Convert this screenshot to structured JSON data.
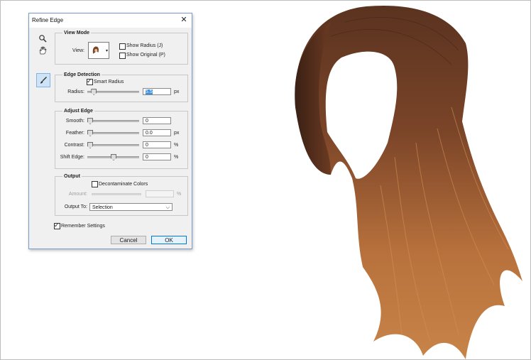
{
  "dialog": {
    "title": "Refine Edge",
    "close_icon": "close-icon",
    "tools": [
      "zoom-icon",
      "hand-icon",
      "refine-radius-brush-icon"
    ]
  },
  "view_mode": {
    "legend": "View Mode",
    "view_label": "View:",
    "show_radius": {
      "label": "Show Radius (J)",
      "checked": false
    },
    "show_original": {
      "label": "Show Original (P)",
      "checked": false
    }
  },
  "edge_detection": {
    "legend": "Edge Detection",
    "smart_radius": {
      "label": "Smart Radius",
      "checked": true
    },
    "radius": {
      "label": "Radius:",
      "value": "5.5",
      "unit": "px",
      "slider_fraction": 0.08
    }
  },
  "adjust_edge": {
    "legend": "Adjust Edge",
    "smooth": {
      "label": "Smooth:",
      "value": "0",
      "unit": "",
      "slider_fraction": 0.0
    },
    "feather": {
      "label": "Feather:",
      "value": "0.0",
      "unit": "px",
      "slider_fraction": 0.0
    },
    "contrast": {
      "label": "Contrast:",
      "value": "0",
      "unit": "%",
      "slider_fraction": 0.0
    },
    "shift_edge": {
      "label": "Shift Edge:",
      "value": "0",
      "unit": "%",
      "slider_fraction": 0.5
    }
  },
  "output": {
    "legend": "Output",
    "decontaminate": {
      "label": "Decontaminate Colors",
      "checked": false
    },
    "amount": {
      "label": "Amount:",
      "value": "",
      "unit": "%",
      "enabled": false
    },
    "output_to_label": "Output To:",
    "output_to_value": "Selection"
  },
  "remember_settings": {
    "label": "Remember Settings",
    "checked": true
  },
  "buttons": {
    "cancel": "Cancel",
    "ok": "OK"
  },
  "colors": {
    "dialog_border": "#7a9cc6",
    "ok_border": "#0078d7",
    "selection": "#3a8de0",
    "hair": "#8a4a22"
  }
}
